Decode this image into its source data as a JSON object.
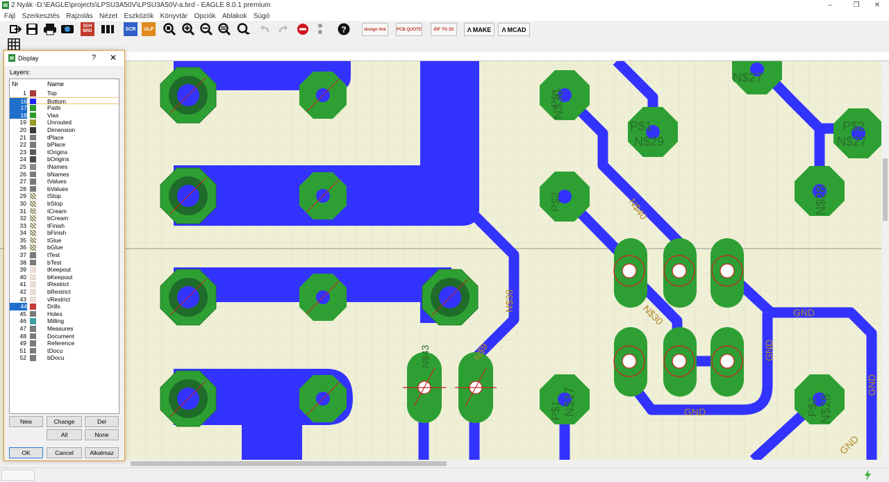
{
  "window": {
    "title": "2 Nyák -D:\\EAGLE\\projects\\LPSU3A50V\\LPSU3A50V-a.brd - EAGLE 8.0.1 premium",
    "controls": [
      "–",
      "❐",
      "✕"
    ]
  },
  "menu": [
    "Fájl",
    "Szerkesztés",
    "Rajzolás",
    "Nézet",
    "Eszközök",
    "Könyvtár",
    "Opciók",
    "Ablakok",
    "Súgó"
  ],
  "toolbar": {
    "scr_label": "SCR",
    "ulp_label": "ULP",
    "sch_label": "SCH",
    "brd_label": "BRD",
    "designlink_label": "design link",
    "pcbquote_label": "PCB QUOTE",
    "idf_label": "IDF TO 3D",
    "make_label": "MAKE",
    "mcad_label": "MCAD"
  },
  "colors": {
    "bottom": "#3333ff",
    "pads": "#2ea033",
    "drill": "#cc2222",
    "background": "#efefd6"
  },
  "dialog": {
    "title": "Display",
    "help": "?",
    "close": "✕",
    "layers_label": "Layers:",
    "col_nr": "Nr",
    "col_name": "Name",
    "layers": [
      {
        "nr": "1",
        "name": "Top",
        "color": "#a63a3a",
        "sel": false
      },
      {
        "nr": "16",
        "name": "Bottom",
        "color": "#2323ff",
        "sel": true
      },
      {
        "nr": "17",
        "name": "Pads",
        "color": "#2d9a2d",
        "sel": true
      },
      {
        "nr": "18",
        "name": "Vias",
        "color": "#2d9a2d",
        "sel": true
      },
      {
        "nr": "19",
        "name": "Unrouted",
        "color": "#9a9a2d",
        "sel": false
      },
      {
        "nr": "20",
        "name": "Dimension",
        "color": "#3a3a3a",
        "sel": false
      },
      {
        "nr": "21",
        "name": "tPlace",
        "color": "#7a7a7a",
        "sel": false
      },
      {
        "nr": "22",
        "name": "bPlace",
        "color": "#7a7a7a",
        "sel": false
      },
      {
        "nr": "23",
        "name": "tOrigins",
        "color": "#5a5a5a",
        "sel": false
      },
      {
        "nr": "24",
        "name": "bOrigins",
        "color": "#4a4a4a",
        "sel": false
      },
      {
        "nr": "25",
        "name": "tNames",
        "color": "#8a8a8a",
        "sel": false
      },
      {
        "nr": "26",
        "name": "bNames",
        "color": "#7a7a7a",
        "sel": false
      },
      {
        "nr": "27",
        "name": "tValues",
        "color": "#7a7a7a",
        "sel": false
      },
      {
        "nr": "28",
        "name": "bValues",
        "color": "#7a7a7a",
        "sel": false
      },
      {
        "nr": "29",
        "name": "tStop",
        "color": "hatch",
        "sel": false
      },
      {
        "nr": "30",
        "name": "bStop",
        "color": "hatch",
        "sel": false
      },
      {
        "nr": "31",
        "name": "tCream",
        "color": "hatch",
        "sel": false
      },
      {
        "nr": "32",
        "name": "bCream",
        "color": "hatch",
        "sel": false
      },
      {
        "nr": "33",
        "name": "tFinish",
        "color": "hatch",
        "sel": false
      },
      {
        "nr": "34",
        "name": "bFinish",
        "color": "hatch",
        "sel": false
      },
      {
        "nr": "35",
        "name": "tGlue",
        "color": "hatch",
        "sel": false
      },
      {
        "nr": "36",
        "name": "bGlue",
        "color": "hatch",
        "sel": false
      },
      {
        "nr": "37",
        "name": "tTest",
        "color": "#7a7a7a",
        "sel": false
      },
      {
        "nr": "38",
        "name": "bTest",
        "color": "#7a7a7a",
        "sel": false
      },
      {
        "nr": "39",
        "name": "tKeepout",
        "color": "dots",
        "sel": false
      },
      {
        "nr": "40",
        "name": "bKeepout",
        "color": "dots",
        "sel": false
      },
      {
        "nr": "41",
        "name": "tRestrict",
        "color": "dots",
        "sel": false
      },
      {
        "nr": "42",
        "name": "bRestrict",
        "color": "dots",
        "sel": false
      },
      {
        "nr": "43",
        "name": "vRestrict",
        "color": "dots",
        "sel": false
      },
      {
        "nr": "44",
        "name": "Drills",
        "color": "#c83a3a",
        "sel": true
      },
      {
        "nr": "45",
        "name": "Holes",
        "color": "#7a7a7a",
        "sel": false
      },
      {
        "nr": "46",
        "name": "Milling",
        "color": "#3aa0a0",
        "sel": false
      },
      {
        "nr": "47",
        "name": "Measures",
        "color": "#7a7a7a",
        "sel": false
      },
      {
        "nr": "48",
        "name": "Document",
        "color": "#7a7a7a",
        "sel": false
      },
      {
        "nr": "49",
        "name": "Reference",
        "color": "#7a7a7a",
        "sel": false
      },
      {
        "nr": "51",
        "name": "tDocu",
        "color": "#7a7a7a",
        "sel": false
      },
      {
        "nr": "52",
        "name": "bDocu",
        "color": "#7a7a7a",
        "sel": false
      }
    ],
    "buttons": {
      "new": "New",
      "change": "Change",
      "del": "Del",
      "all": "All",
      "none": "None",
      "ok": "OK",
      "cancel": "Cancel",
      "apply": "Alkalmaz"
    }
  },
  "board_labels": {
    "n29": "N$29",
    "p1a": "P$1",
    "n27": "N$27",
    "p2a": "P$2",
    "n30": "N$30",
    "p1b": "P$1",
    "p2b": "P$2",
    "n28": "N$28",
    "n38": "N$38",
    "n40": "N$40",
    "n30b": "N$30",
    "gnd1": "GND",
    "gnd2": "GND",
    "gnd3": "GND",
    "gnd4": "GND",
    "gnd5": "GND",
    "n43": "N$43",
    "n9": "N$9",
    "p1c": "P$1",
    "n17": "N$17",
    "p2c": "P$2",
    "n28b": "N$28",
    "n27b": "N$27"
  }
}
